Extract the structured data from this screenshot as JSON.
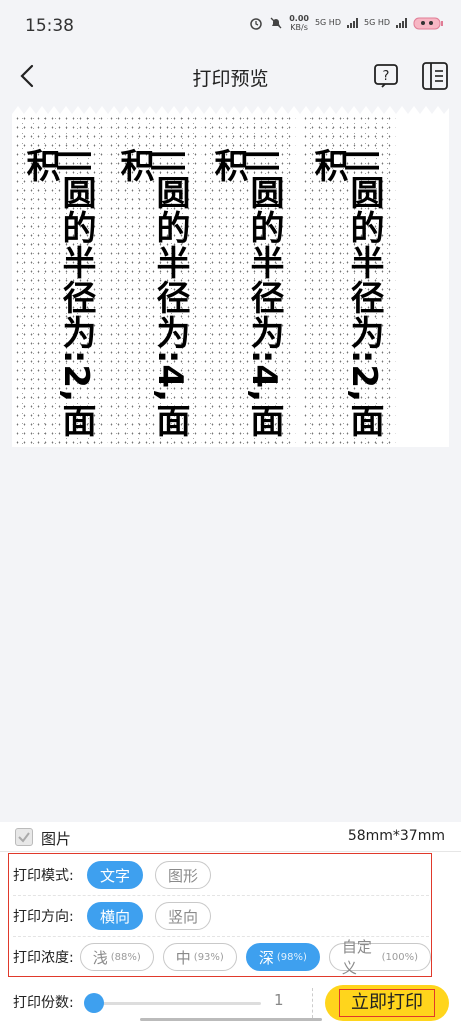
{
  "status": {
    "time": "15:38",
    "net_speed": "0.00",
    "net_unit": "KB/s",
    "sim1": "5G HD",
    "sim2": "5G HD"
  },
  "nav": {
    "title": "打印预览"
  },
  "preview": {
    "strips": [
      {
        "text": "||圆的半径为:2,面积"
      },
      {
        "text": "||圆的半径为:4,面积"
      },
      {
        "text": "||圆的半径为:4,面积"
      },
      {
        "text": "||圆的半径为:2,面积"
      }
    ]
  },
  "panel": {
    "image_label": "图片",
    "image_checked": true,
    "size": "58mm*37mm",
    "mode": {
      "label": "打印模式:",
      "options": [
        "文字",
        "图形"
      ],
      "selected": "文字"
    },
    "direction": {
      "label": "打印方向:",
      "options": [
        "横向",
        "竖向"
      ],
      "selected": "横向"
    },
    "density": {
      "label": "打印浓度:",
      "options": [
        {
          "name": "浅",
          "pct": "(88%)"
        },
        {
          "name": "中",
          "pct": "(93%)"
        },
        {
          "name": "深",
          "pct": "(98%)"
        },
        {
          "name": "自定义",
          "pct": "(100%)"
        }
      ],
      "selected": "深"
    },
    "copies": {
      "label": "打印份数:",
      "value": "1"
    },
    "print_button": "立即打印"
  },
  "colors": {
    "accent": "#3ea0ef",
    "button": "#ffd51c",
    "highlight": "#e0392b"
  }
}
